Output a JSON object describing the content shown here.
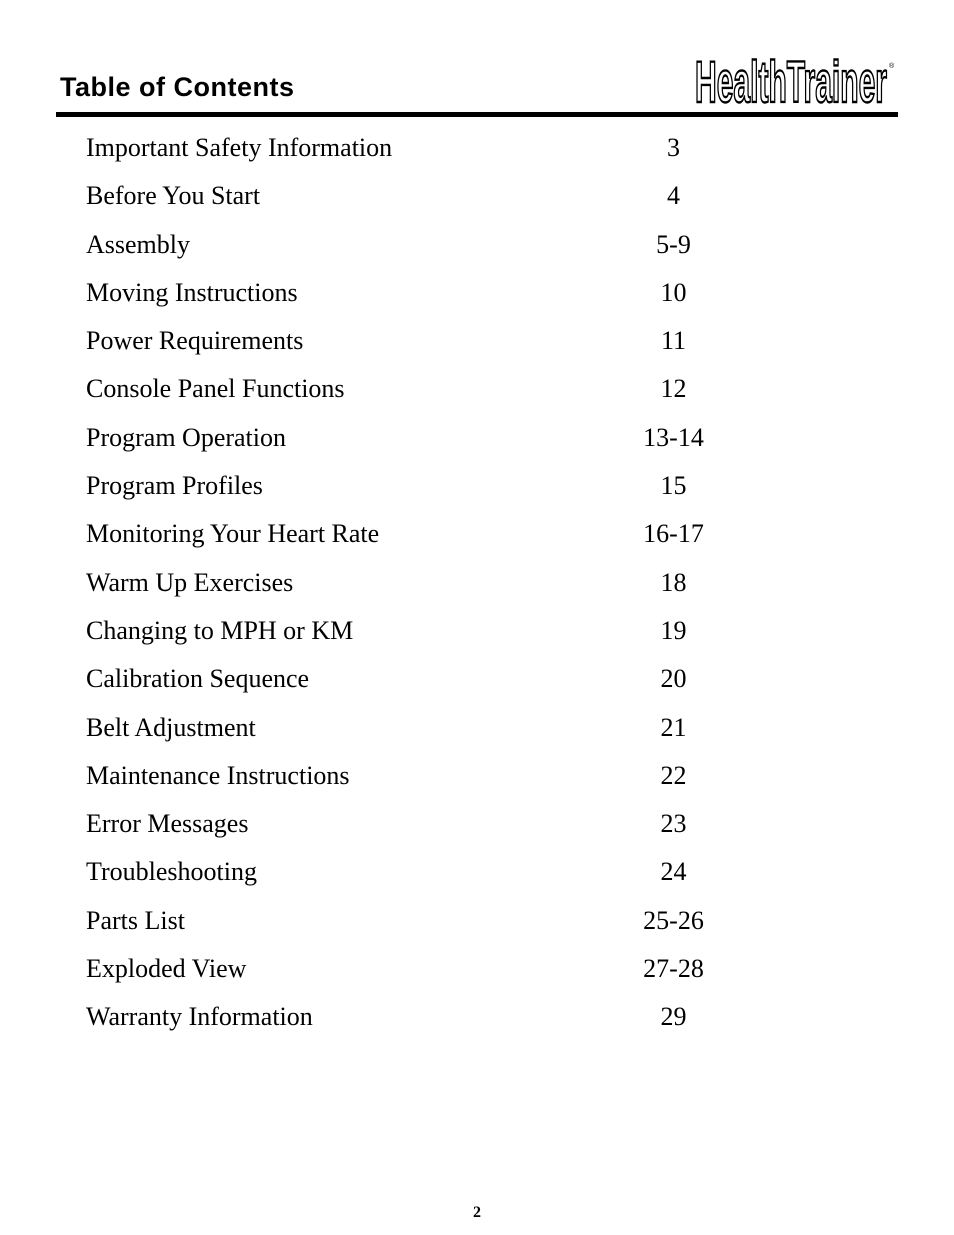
{
  "header": {
    "title": "Table of Contents",
    "logo_text": "HealthTrainer",
    "logo_mark": "®"
  },
  "toc": [
    {
      "title": "Important Safety Information",
      "page": "3"
    },
    {
      "title": "Before You Start",
      "page": "4"
    },
    {
      "title": "Assembly",
      "page": "5-9"
    },
    {
      "title": "Moving Instructions",
      "page": "10"
    },
    {
      "title": "Power Requirements",
      "page": "11"
    },
    {
      "title": "Console Panel Functions",
      "page": "12"
    },
    {
      "title": "Program Operation",
      "page": "13-14"
    },
    {
      "title": "Program Profiles",
      "page": "15"
    },
    {
      "title": "Monitoring Your Heart Rate",
      "page": "16-17"
    },
    {
      "title": "Warm Up Exercises",
      "page": "18"
    },
    {
      "title": "Changing to MPH or KM",
      "page": "19"
    },
    {
      "title": "Calibration Sequence",
      "page": "20"
    },
    {
      "title": "Belt Adjustment",
      "page": "21"
    },
    {
      "title": "Maintenance Instructions",
      "page": "22"
    },
    {
      "title": "Error Messages",
      "page": "23"
    },
    {
      "title": "Troubleshooting",
      "page": "24"
    },
    {
      "title": "Parts List",
      "page": "25-26"
    },
    {
      "title": "Exploded View",
      "page": "27-28"
    },
    {
      "title": "Warranty Information",
      "page": "29"
    }
  ],
  "footer": {
    "page_number": "2"
  }
}
